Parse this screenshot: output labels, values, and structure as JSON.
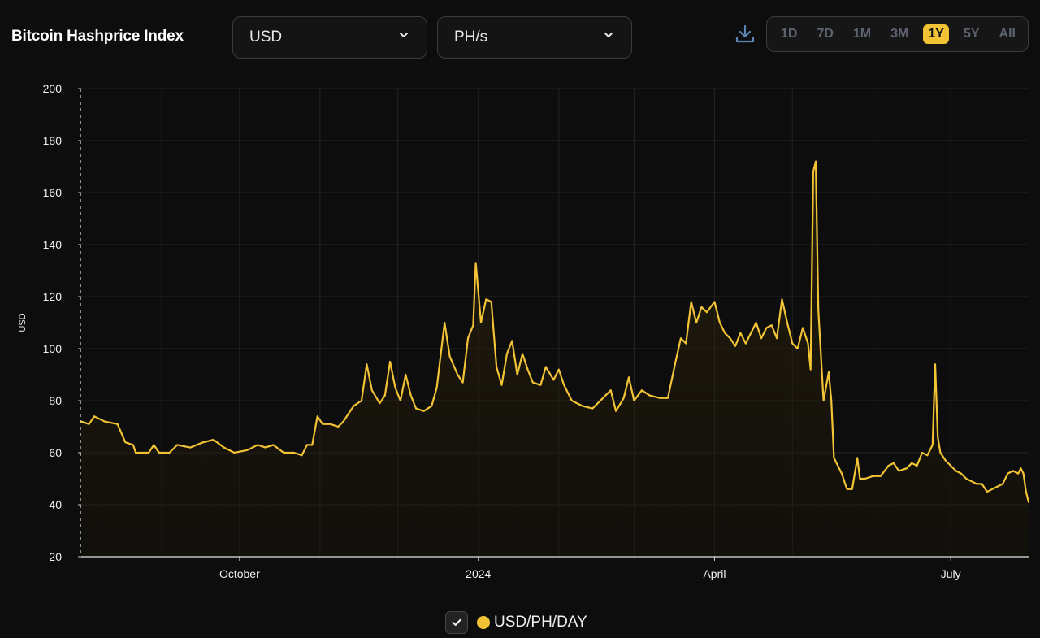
{
  "header": {
    "title": "Bitcoin Hashprice Index"
  },
  "controls": {
    "currency": {
      "selected": "USD",
      "icon": "chevron-down-icon"
    },
    "unit": {
      "selected": "PH/s",
      "icon": "chevron-down-icon"
    },
    "download_icon": "download-icon",
    "ranges": [
      "1D",
      "7D",
      "1M",
      "3M",
      "1Y",
      "5Y",
      "All"
    ],
    "active_range": "1Y"
  },
  "legend": {
    "label": "USD/PH/DAY",
    "checked": true,
    "color": "#f2c335"
  },
  "chart_data": {
    "type": "area",
    "ylabel": "USD",
    "xlabel": "",
    "ylim": [
      20,
      200
    ],
    "yticks": [
      20,
      40,
      60,
      80,
      100,
      120,
      140,
      160,
      180,
      200
    ],
    "x_start": "2023-08-01",
    "x_end": "2024-07-31",
    "xticks": [
      {
        "label": "October",
        "date": "2023-10-01"
      },
      {
        "label": "2024",
        "date": "2024-01-01"
      },
      {
        "label": "April",
        "date": "2024-04-01"
      },
      {
        "label": "July",
        "date": "2024-07-01"
      }
    ],
    "grid": true,
    "line_color": "#f2c335",
    "series": [
      {
        "name": "USD/PH/DAY",
        "points": [
          [
            "2023-08-01",
            72
          ],
          [
            "2023-08-04",
            71
          ],
          [
            "2023-08-06",
            74
          ],
          [
            "2023-08-10",
            72
          ],
          [
            "2023-08-15",
            71
          ],
          [
            "2023-08-18",
            64
          ],
          [
            "2023-08-21",
            63
          ],
          [
            "2023-08-22",
            60
          ],
          [
            "2023-08-27",
            60
          ],
          [
            "2023-08-29",
            63
          ],
          [
            "2023-08-31",
            60
          ],
          [
            "2023-09-04",
            60
          ],
          [
            "2023-09-07",
            63
          ],
          [
            "2023-09-12",
            62
          ],
          [
            "2023-09-17",
            64
          ],
          [
            "2023-09-21",
            65
          ],
          [
            "2023-09-25",
            62
          ],
          [
            "2023-09-29",
            60
          ],
          [
            "2023-10-04",
            61
          ],
          [
            "2023-10-08",
            63
          ],
          [
            "2023-10-11",
            62
          ],
          [
            "2023-10-14",
            63
          ],
          [
            "2023-10-18",
            60
          ],
          [
            "2023-10-22",
            60
          ],
          [
            "2023-10-25",
            59
          ],
          [
            "2023-10-27",
            63
          ],
          [
            "2023-10-29",
            63
          ],
          [
            "2023-10-31",
            74
          ],
          [
            "2023-11-02",
            71
          ],
          [
            "2023-11-05",
            71
          ],
          [
            "2023-11-08",
            70
          ],
          [
            "2023-11-10",
            72
          ],
          [
            "2023-11-14",
            78
          ],
          [
            "2023-11-17",
            80
          ],
          [
            "2023-11-19",
            94
          ],
          [
            "2023-11-21",
            84
          ],
          [
            "2023-11-24",
            79
          ],
          [
            "2023-11-26",
            82
          ],
          [
            "2023-11-28",
            95
          ],
          [
            "2023-11-30",
            85
          ],
          [
            "2023-12-02",
            80
          ],
          [
            "2023-12-04",
            90
          ],
          [
            "2023-12-06",
            82
          ],
          [
            "2023-12-08",
            77
          ],
          [
            "2023-12-11",
            76
          ],
          [
            "2023-12-14",
            78
          ],
          [
            "2023-12-16",
            85
          ],
          [
            "2023-12-19",
            110
          ],
          [
            "2023-12-21",
            97
          ],
          [
            "2023-12-24",
            90
          ],
          [
            "2023-12-26",
            87
          ],
          [
            "2023-12-28",
            104
          ],
          [
            "2023-12-30",
            109
          ],
          [
            "2023-12-31",
            133
          ],
          [
            "2024-01-02",
            110
          ],
          [
            "2024-01-04",
            119
          ],
          [
            "2024-01-06",
            118
          ],
          [
            "2024-01-08",
            93
          ],
          [
            "2024-01-10",
            86
          ],
          [
            "2024-01-12",
            98
          ],
          [
            "2024-01-14",
            103
          ],
          [
            "2024-01-16",
            90
          ],
          [
            "2024-01-18",
            98
          ],
          [
            "2024-01-20",
            92
          ],
          [
            "2024-01-22",
            87
          ],
          [
            "2024-01-25",
            86
          ],
          [
            "2024-01-27",
            93
          ],
          [
            "2024-01-30",
            88
          ],
          [
            "2024-02-01",
            92
          ],
          [
            "2024-02-03",
            86
          ],
          [
            "2024-02-06",
            80
          ],
          [
            "2024-02-10",
            78
          ],
          [
            "2024-02-14",
            77
          ],
          [
            "2024-02-18",
            81
          ],
          [
            "2024-02-21",
            84
          ],
          [
            "2024-02-23",
            76
          ],
          [
            "2024-02-26",
            81
          ],
          [
            "2024-02-28",
            89
          ],
          [
            "2024-03-01",
            80
          ],
          [
            "2024-03-04",
            84
          ],
          [
            "2024-03-07",
            82
          ],
          [
            "2024-03-11",
            81
          ],
          [
            "2024-03-14",
            81
          ],
          [
            "2024-03-17",
            95
          ],
          [
            "2024-03-19",
            104
          ],
          [
            "2024-03-21",
            102
          ],
          [
            "2024-03-23",
            118
          ],
          [
            "2024-03-25",
            110
          ],
          [
            "2024-03-27",
            116
          ],
          [
            "2024-03-29",
            114
          ],
          [
            "2024-04-01",
            118
          ],
          [
            "2024-04-03",
            110
          ],
          [
            "2024-04-05",
            106
          ],
          [
            "2024-04-07",
            104
          ],
          [
            "2024-04-09",
            101
          ],
          [
            "2024-04-11",
            106
          ],
          [
            "2024-04-13",
            102
          ],
          [
            "2024-04-15",
            106
          ],
          [
            "2024-04-17",
            110
          ],
          [
            "2024-04-19",
            104
          ],
          [
            "2024-04-21",
            108
          ],
          [
            "2024-04-23",
            109
          ],
          [
            "2024-04-25",
            104
          ],
          [
            "2024-04-27",
            119
          ],
          [
            "2024-04-29",
            110
          ],
          [
            "2024-05-01",
            102
          ],
          [
            "2024-05-03",
            100
          ],
          [
            "2024-05-05",
            108
          ],
          [
            "2024-05-07",
            102
          ],
          [
            "2024-05-08",
            92
          ],
          [
            "2024-05-09",
            168
          ],
          [
            "2024-05-10",
            172
          ],
          [
            "2024-05-11",
            115
          ],
          [
            "2024-05-13",
            80
          ],
          [
            "2024-05-15",
            91
          ],
          [
            "2024-05-16",
            80
          ],
          [
            "2024-05-17",
            58
          ],
          [
            "2024-05-18",
            56
          ],
          [
            "2024-05-20",
            52
          ],
          [
            "2024-05-22",
            46
          ],
          [
            "2024-05-24",
            46
          ],
          [
            "2024-05-26",
            58
          ],
          [
            "2024-05-27",
            50
          ],
          [
            "2024-05-29",
            50
          ],
          [
            "2024-06-01",
            51
          ],
          [
            "2024-06-04",
            51
          ],
          [
            "2024-06-07",
            55
          ],
          [
            "2024-06-09",
            56
          ],
          [
            "2024-06-11",
            53
          ],
          [
            "2024-06-14",
            54
          ],
          [
            "2024-06-16",
            56
          ],
          [
            "2024-06-18",
            55
          ],
          [
            "2024-06-20",
            60
          ],
          [
            "2024-06-22",
            59
          ],
          [
            "2024-06-24",
            63
          ],
          [
            "2024-06-25",
            94
          ],
          [
            "2024-06-26",
            66
          ],
          [
            "2024-06-27",
            60
          ],
          [
            "2024-06-29",
            57
          ],
          [
            "2024-07-01",
            55
          ],
          [
            "2024-07-03",
            53
          ],
          [
            "2024-07-05",
            52
          ],
          [
            "2024-07-07",
            50
          ],
          [
            "2024-07-09",
            49
          ],
          [
            "2024-07-11",
            48
          ],
          [
            "2024-07-13",
            48
          ],
          [
            "2024-07-15",
            45
          ],
          [
            "2024-07-17",
            46
          ],
          [
            "2024-07-19",
            47
          ],
          [
            "2024-07-21",
            48
          ],
          [
            "2024-07-23",
            52
          ],
          [
            "2024-07-25",
            53
          ],
          [
            "2024-07-27",
            52
          ],
          [
            "2024-07-28",
            54
          ],
          [
            "2024-07-29",
            52
          ],
          [
            "2024-07-30",
            45
          ],
          [
            "2024-07-31",
            41
          ]
        ]
      }
    ]
  }
}
